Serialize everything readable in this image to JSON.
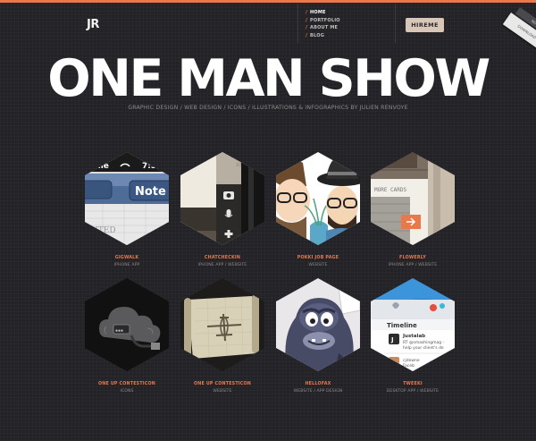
{
  "header": {
    "logo": "JR",
    "nav": [
      {
        "label": "HOME",
        "active": true
      },
      {
        "label": "PORTFOLIO",
        "active": false
      },
      {
        "label": "ABOUT ME",
        "active": false
      },
      {
        "label": "BLOG",
        "active": false
      }
    ],
    "hire_button": "HIREME",
    "ribbon_text": "DOWNLOAD",
    "ribbon_dark_text": "NOTE"
  },
  "hero": {
    "title": "ONE MAN SHOW",
    "tagline": "GRAPHIC DESIGN / WEB DESIGN / ICONS / ILLUSTRATIONS & INFOGRAPHICS BY JULIEN RENVOYE"
  },
  "portfolio": [
    {
      "title": "GIGWALK",
      "subtitle": "IPHONE APP",
      "thumb_text": [
        "obile",
        "7:5",
        "Note",
        "DITED"
      ]
    },
    {
      "title": "CHATCHECKIN",
      "subtitle": "IPHONE APP / WEBSITE",
      "thumb_text": [
        "10s"
      ]
    },
    {
      "title": "POKKI JOB PAGE",
      "subtitle": "WEBSITE",
      "thumb_text": []
    },
    {
      "title": "FLOWERLY",
      "subtitle": "IPHONE APP / WEBSITE",
      "thumb_text": [
        "end",
        "MORE CARDS"
      ]
    },
    {
      "title": "ONE UP CONTESTICON",
      "subtitle": "ICONS",
      "thumb_text": []
    },
    {
      "title": "ONE UP CONTESTICON",
      "subtitle": "WEBSITE",
      "thumb_text": []
    },
    {
      "title": "HELLOFAX",
      "subtitle": "WEBSITE / APP DESIGN",
      "thumb_text": []
    },
    {
      "title": "TWEEKI",
      "subtitle": "DESKTOP APP / WEBSITE",
      "thumb_text": [
        "Timeline",
        "Justalab",
        "RT @smashingmag -",
        "help your client's de",
        "cjdowne",
        "Faceb"
      ]
    }
  ],
  "colors": {
    "accent": "#e9784a",
    "background": "#232226",
    "button_bg": "#d8c7b8"
  }
}
